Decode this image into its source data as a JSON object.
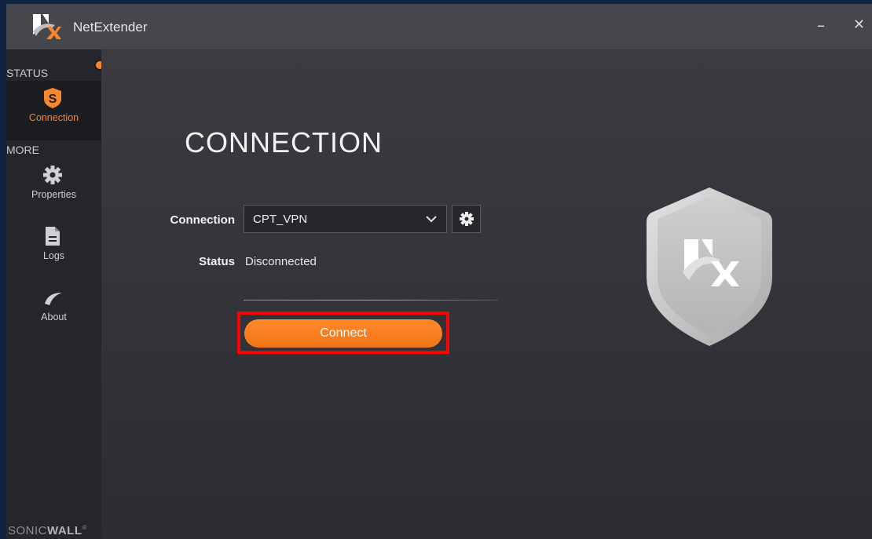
{
  "window": {
    "title": "NetExtender",
    "minimize_label": "–",
    "close_label": "✕"
  },
  "sidebar": {
    "status_section": "STATUS",
    "more_section": "MORE",
    "items": [
      {
        "label": "Connection",
        "icon": "shield-s-icon",
        "active": true
      },
      {
        "label": "Properties",
        "icon": "gear-icon"
      },
      {
        "label": "Logs",
        "icon": "document-icon"
      },
      {
        "label": "About",
        "icon": "swoosh-icon"
      }
    ],
    "brand_light": "SONIC",
    "brand_bold": "WALL",
    "brand_mark": "®"
  },
  "main": {
    "title": "CONNECTION",
    "connection_label": "Connection",
    "connection_value": "CPT_VPN",
    "status_label": "Status",
    "status_value": "Disconnected",
    "connect_label": "Connect"
  },
  "colors": {
    "accent": "#f7872d",
    "highlight": "#ff0000"
  }
}
